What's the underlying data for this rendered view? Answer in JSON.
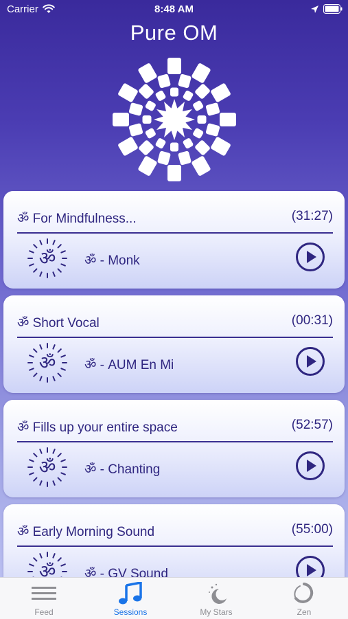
{
  "status_bar": {
    "carrier": "Carrier",
    "time": "8:48 AM"
  },
  "app": {
    "title": "Pure OM"
  },
  "om_symbol": "ॐ",
  "sessions": [
    {
      "title": "ॐ For Mindfulness...",
      "duration": "(31:27)",
      "track": "ॐ - Monk"
    },
    {
      "title": "ॐ Short Vocal",
      "duration": "(00:31)",
      "track": "ॐ - AUM En Mi"
    },
    {
      "title": "ॐ Fills up your entire space",
      "duration": "(52:57)",
      "track": "ॐ - Chanting"
    },
    {
      "title": "ॐ Early Morning Sound",
      "duration": "(55:00)",
      "track": "ॐ - GV Sound"
    }
  ],
  "tabs": [
    {
      "label": "Feed",
      "icon": "menu-lines-icon",
      "active": false
    },
    {
      "label": "Sessions",
      "icon": "music-note-icon",
      "active": true
    },
    {
      "label": "My Stars",
      "icon": "moon-stars-icon",
      "active": false
    },
    {
      "label": "Zen",
      "icon": "zen-circle-icon",
      "active": false
    }
  ],
  "colors": {
    "accent_purple": "#2f2680",
    "tab_active": "#1a74e8",
    "tab_inactive": "#8e8e93",
    "gradient_top": "#3a2a9c",
    "gradient_bottom": "#c3c8f4"
  }
}
